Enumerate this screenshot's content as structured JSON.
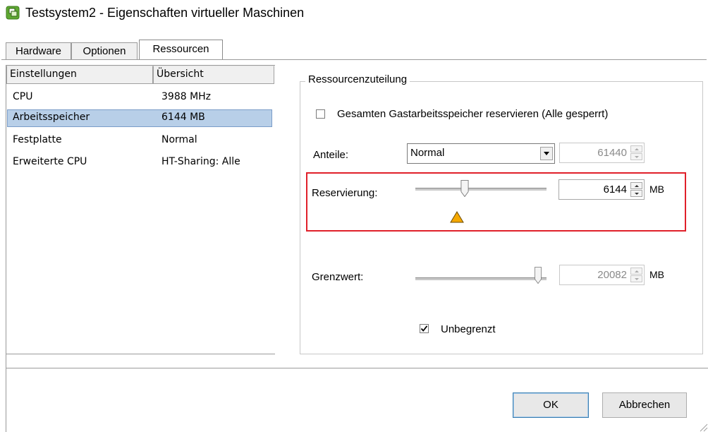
{
  "window": {
    "title": "Testsystem2 - Eigenschaften virtueller Maschinen"
  },
  "tabs": [
    {
      "label": "Hardware"
    },
    {
      "label": "Optionen"
    },
    {
      "label": "Ressourcen"
    }
  ],
  "settings_list": {
    "headers": [
      "Einstellungen",
      "Übersicht"
    ],
    "rows": [
      {
        "name": "CPU",
        "value": "3988 MHz"
      },
      {
        "name": "Arbeitsspeicher",
        "value": "6144 MB"
      },
      {
        "name": "Festplatte",
        "value": "Normal"
      },
      {
        "name": "Erweiterte CPU",
        "value": "HT-Sharing: Alle"
      }
    ],
    "selected_index": 1
  },
  "resource_group": {
    "title": "Ressourcenzuteilung",
    "reserve_all_label": "Gesamten Gastarbeitsspeicher reservieren (Alle gesperrt)",
    "reserve_all_checked": false,
    "shares_label": "Anteile:",
    "shares_value": "Normal",
    "shares_number": "61440",
    "reservation_label": "Reservierung:",
    "reservation_value": "6144",
    "reservation_unit": "MB",
    "reservation_slider_fraction": 0.36,
    "limit_label": "Grenzwert:",
    "limit_value": "20082",
    "limit_unit": "MB",
    "limit_slider_fraction": 1.0,
    "unlimited_label": "Unbegrenzt",
    "unlimited_checked": true
  },
  "buttons": {
    "ok": "OK",
    "cancel": "Abbrechen"
  },
  "colors": {
    "selection": "#b8cfe8",
    "highlight_box": "#e0202a",
    "warning": "#f5a800"
  }
}
